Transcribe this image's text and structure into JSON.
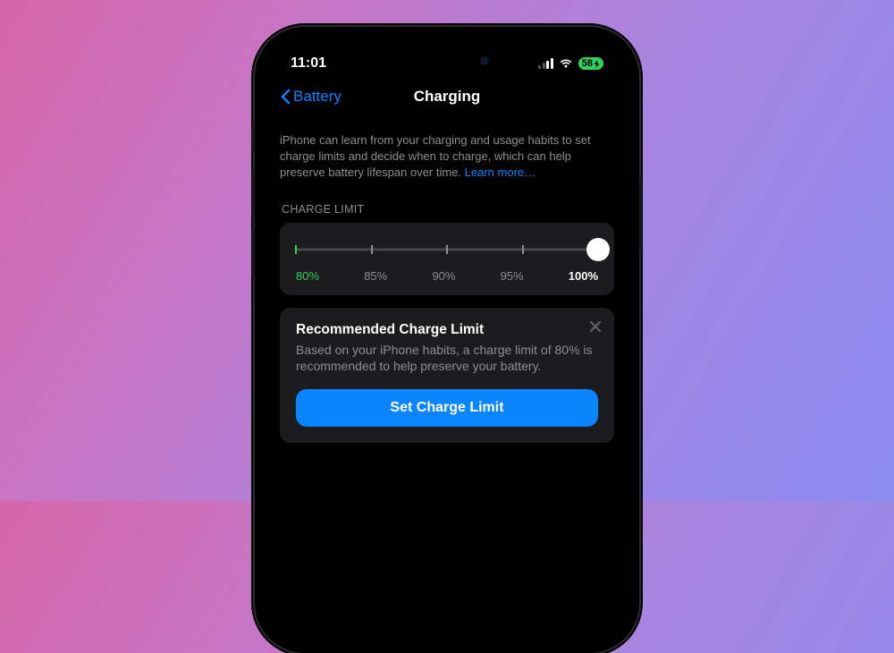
{
  "status": {
    "time": "11:01",
    "battery_text": "58",
    "signal_bars": 2,
    "signal_total": 4
  },
  "nav": {
    "back_label": "Battery",
    "title": "Charging"
  },
  "intro": {
    "text": "iPhone can learn from your charging and usage habits to set charge limits and decide when to charge, which can help preserve battery lifespan over time. ",
    "link_text": "Learn more…"
  },
  "charge_limit": {
    "section_label": "CHARGE LIMIT",
    "options": [
      "80%",
      "85%",
      "90%",
      "95%",
      "100%"
    ],
    "current_index": 4
  },
  "recommendation": {
    "title": "Recommended Charge Limit",
    "body": "Based on your iPhone habits, a charge limit of 80% is recommended to help preserve your battery.",
    "button_label": "Set Charge Limit"
  }
}
